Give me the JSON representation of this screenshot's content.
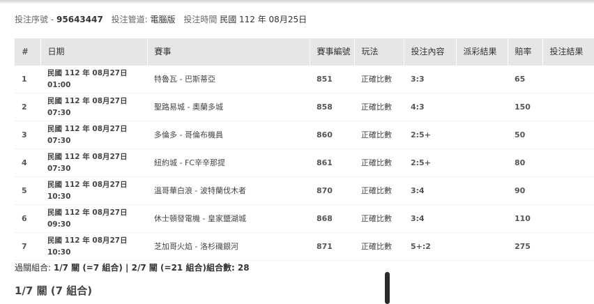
{
  "ticket": {
    "serial_label": "投注序號",
    "serial_sep": "-",
    "serial_value": "95643447",
    "channel_label": "投注管道:",
    "channel_value": "電腦版",
    "time_label": "投注時間",
    "time_value": "民國 112 年 08月25日"
  },
  "table": {
    "headers": [
      "#",
      "日期",
      "賽事",
      "賽事編號",
      "玩法",
      "投注內容",
      "派彩結果",
      "賠率",
      "投注結果"
    ],
    "rows": [
      {
        "no": "1",
        "date_line1": "民國 112 年 08月27日",
        "date_line2": "01:00",
        "match": "特魯瓦 - 巴斯蒂亞",
        "code": "851",
        "play": "正確比數",
        "bet": "3:3",
        "payout": "",
        "odds": "65",
        "result": ""
      },
      {
        "no": "2",
        "date_line1": "民國 112 年 08月27日",
        "date_line2": "07:30",
        "match": "聖路易城 - 奧蘭多城",
        "code": "858",
        "play": "正確比數",
        "bet": "4:3",
        "payout": "",
        "odds": "150",
        "result": ""
      },
      {
        "no": "3",
        "date_line1": "民國 112 年 08月27日",
        "date_line2": "07:30",
        "match": "多倫多 - 哥倫布機員",
        "code": "860",
        "play": "正確比數",
        "bet": "2:5+",
        "payout": "",
        "odds": "50",
        "result": ""
      },
      {
        "no": "4",
        "date_line1": "民國 112 年 08月27日",
        "date_line2": "07:30",
        "match": "紐約城 - FC辛辛那提",
        "code": "861",
        "play": "正確比數",
        "bet": "2:5+",
        "payout": "",
        "odds": "80",
        "result": ""
      },
      {
        "no": "5",
        "date_line1": "民國 112 年 08月27日",
        "date_line2": "10:30",
        "match": "溫哥華白浪 - 波特蘭伐木者",
        "code": "870",
        "play": "正確比數",
        "bet": "3:4",
        "payout": "",
        "odds": "90",
        "result": ""
      },
      {
        "no": "6",
        "date_line1": "民國 112 年 08月27日",
        "date_line2": "09:30",
        "match": "休士頓發電機 - 皇家鹽湖城",
        "code": "868",
        "play": "正確比數",
        "bet": "3:4",
        "payout": "",
        "odds": "110",
        "result": ""
      },
      {
        "no": "7",
        "date_line1": "民國 112 年 08月27日",
        "date_line2": "10:30",
        "match": "芝加哥火焰 - 洛杉磯銀河",
        "code": "871",
        "play": "正確比數",
        "bet": "5+:2",
        "payout": "",
        "odds": "275",
        "result": ""
      }
    ]
  },
  "summary": {
    "label": "過關組合:",
    "text": "1/7 關 (=7 組合) | 2/7 關 (=21 組合)組合數: 28"
  },
  "section": {
    "title": "1/7 關 (7 組合)"
  }
}
